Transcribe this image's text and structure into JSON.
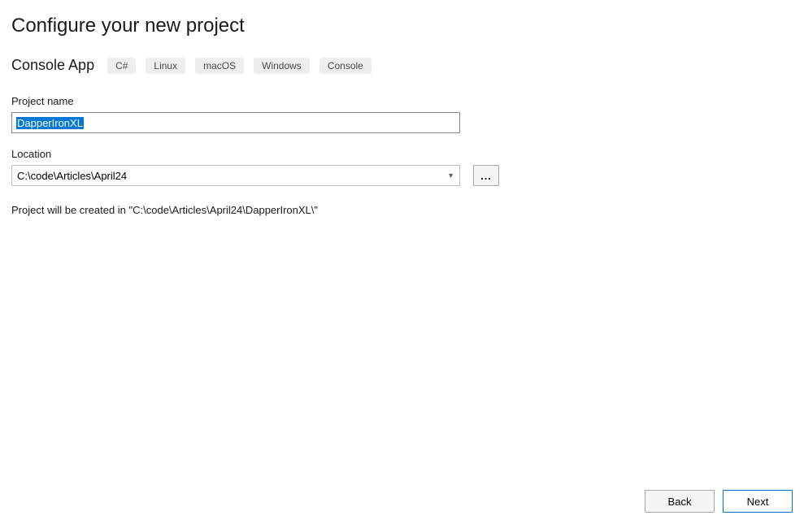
{
  "header": {
    "title": "Configure your new project"
  },
  "template": {
    "name": "Console App",
    "tags": [
      "C#",
      "Linux",
      "macOS",
      "Windows",
      "Console"
    ]
  },
  "fields": {
    "project_name": {
      "label": "Project name",
      "value": "DapperIronXL"
    },
    "location": {
      "label": "Location",
      "value": "C:\\code\\Articles\\April24",
      "browse_label": "..."
    }
  },
  "info_text": "Project will be created in \"C:\\code\\Articles\\April24\\DapperIronXL\\\"",
  "footer": {
    "back_label": "Back",
    "next_label": "Next"
  }
}
